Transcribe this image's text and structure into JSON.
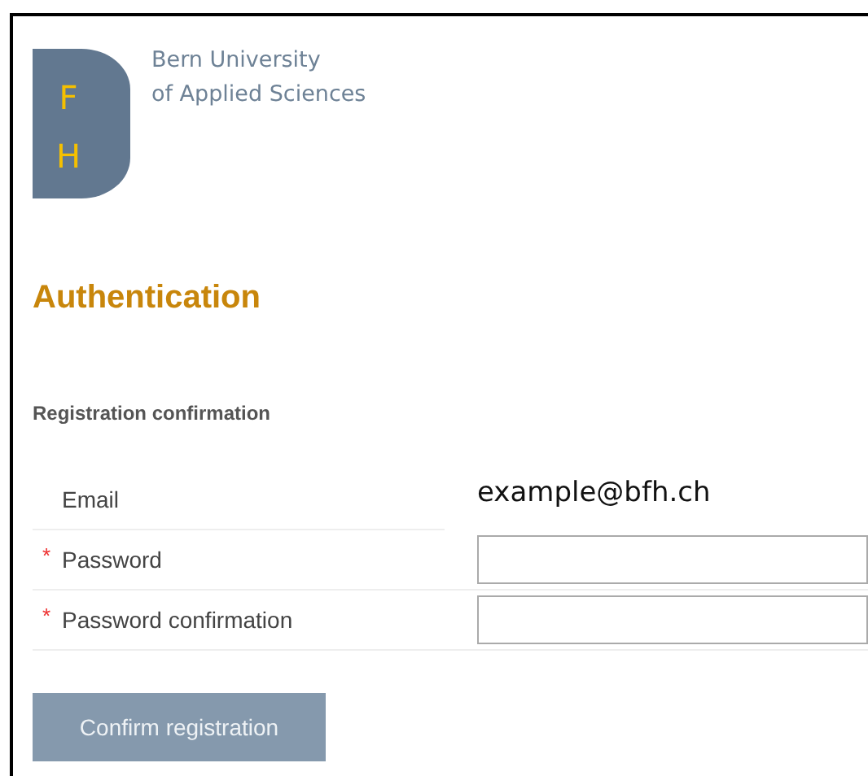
{
  "logo": {
    "letters": [
      "F",
      "H"
    ],
    "name_lines": [
      "Bern University",
      "of Applied Sciences"
    ]
  },
  "heading": "Authentication",
  "section_title": "Registration confirmation",
  "rows": [
    {
      "label": "Email",
      "required": false,
      "kind": "text",
      "value": "example@bfh.ch"
    },
    {
      "label": "Password",
      "required": true,
      "kind": "input"
    },
    {
      "label": "Password confirmation",
      "required": true,
      "kind": "input"
    }
  ],
  "submit_button": "Confirm registration",
  "required_mark": "*"
}
